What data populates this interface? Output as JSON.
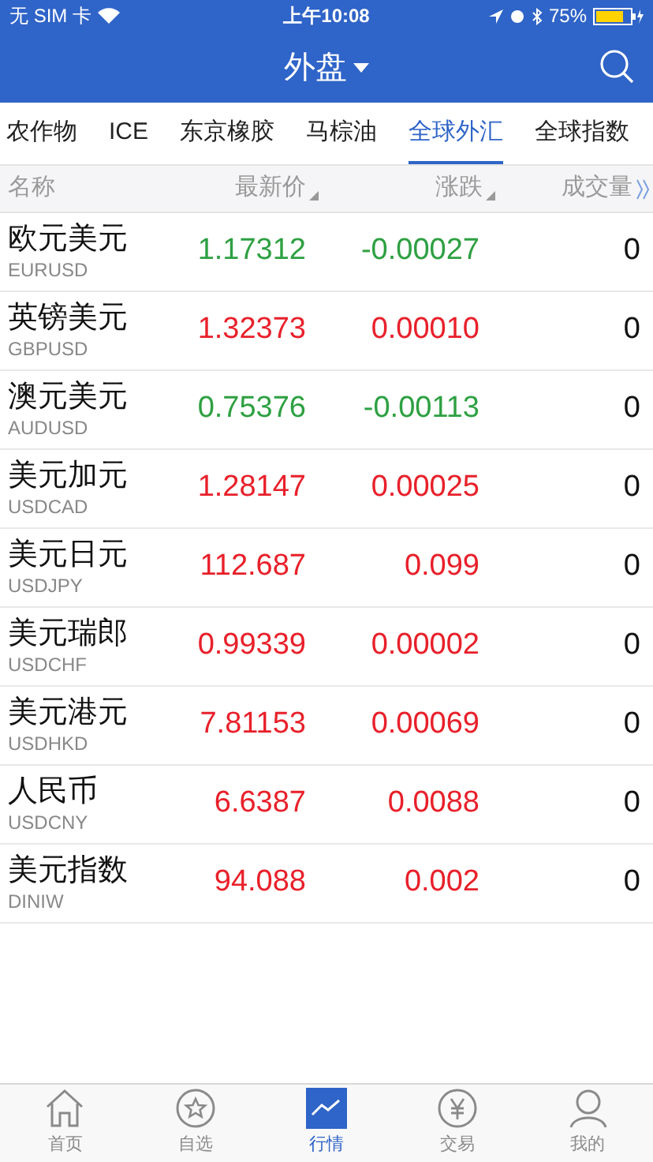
{
  "status_bar": {
    "carrier": "无 SIM 卡",
    "time": "上午10:08",
    "battery": "75%"
  },
  "header": {
    "title": "外盘"
  },
  "tabs": [
    {
      "label": "农作物",
      "selected": false
    },
    {
      "label": "ICE",
      "selected": false
    },
    {
      "label": "东京橡胶",
      "selected": false
    },
    {
      "label": "马棕油",
      "selected": false
    },
    {
      "label": "全球外汇",
      "selected": true
    },
    {
      "label": "全球指数",
      "selected": false
    }
  ],
  "table": {
    "columns": [
      "名称",
      "最新价",
      "涨跌",
      "成交量"
    ],
    "rows": [
      {
        "name": "欧元美元",
        "code": "EURUSD",
        "price": "1.17312",
        "change": "-0.00027",
        "volume": "0",
        "kind": "down"
      },
      {
        "name": "英镑美元",
        "code": "GBPUSD",
        "price": "1.32373",
        "change": "0.00010",
        "volume": "0",
        "kind": "up"
      },
      {
        "name": "澳元美元",
        "code": "AUDUSD",
        "price": "0.75376",
        "change": "-0.00113",
        "volume": "0",
        "kind": "down"
      },
      {
        "name": "美元加元",
        "code": "USDCAD",
        "price": "1.28147",
        "change": "0.00025",
        "volume": "0",
        "kind": "up"
      },
      {
        "name": "美元日元",
        "code": "USDJPY",
        "price": "112.687",
        "change": "0.099",
        "volume": "0",
        "kind": "up"
      },
      {
        "name": "美元瑞郎",
        "code": "USDCHF",
        "price": "0.99339",
        "change": "0.00002",
        "volume": "0",
        "kind": "up"
      },
      {
        "name": "美元港元",
        "code": "USDHKD",
        "price": "7.81153",
        "change": "0.00069",
        "volume": "0",
        "kind": "up"
      },
      {
        "name": "人民币",
        "code": "USDCNY",
        "price": "6.6387",
        "change": "0.0088",
        "volume": "0",
        "kind": "up"
      },
      {
        "name": "美元指数",
        "code": "DINIW",
        "price": "94.088",
        "change": "0.002",
        "volume": "0",
        "kind": "up"
      }
    ]
  },
  "tab_bar": [
    {
      "label": "首页",
      "selected": false
    },
    {
      "label": "自选",
      "selected": false
    },
    {
      "label": "行情",
      "selected": true
    },
    {
      "label": "交易",
      "selected": false
    },
    {
      "label": "我的",
      "selected": false
    }
  ]
}
